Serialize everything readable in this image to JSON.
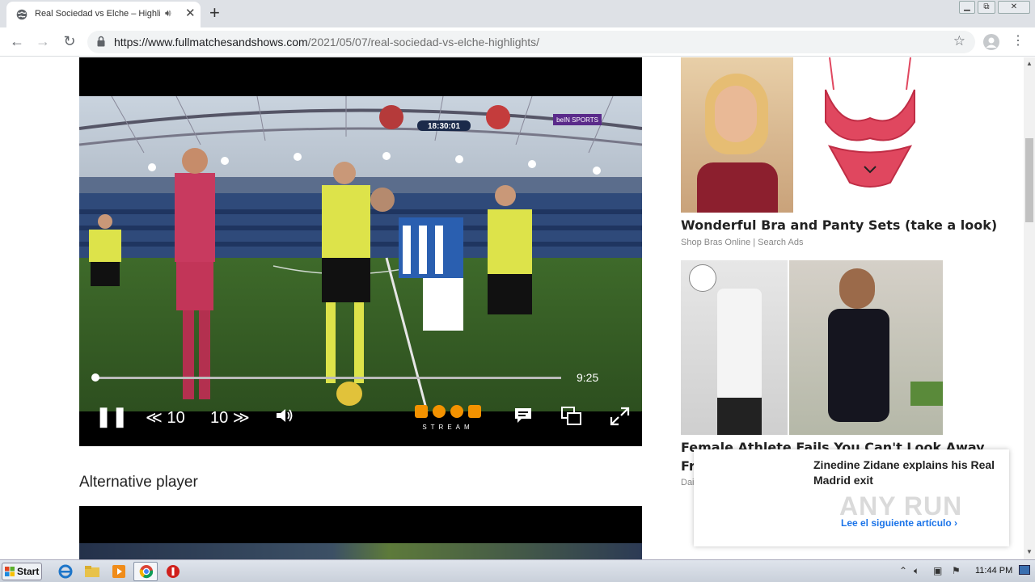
{
  "browser": {
    "tab_title": "Real Sociedad vs Elche – Highlig",
    "url_host": "https://www.fullmatchesandshows.com",
    "url_path": "/2021/05/07/real-sociedad-vs-elche-highlights/",
    "window_buttons": [
      "▭",
      "⧉",
      "✕"
    ]
  },
  "player": {
    "score_clock": "18:30:01",
    "channel": "beIN SPORTS",
    "time_remaining": "9:25",
    "progress": 0.0,
    "rewind_label": "10",
    "forward_label": "10",
    "brand": "STREAM"
  },
  "alternative": {
    "heading": "Alternative player"
  },
  "ads": [
    {
      "title": "Wonderful Bra and Panty Sets (take a look)",
      "source": "Shop Bras Online | Search Ads"
    },
    {
      "title": "Female Athlete Fails You Can't Look Away",
      "title_line2": "Fr",
      "source": "Dai"
    }
  ],
  "popup": {
    "title": "Zinedine Zidane explains his Real Madrid exit",
    "link": "Lee el siguiente artículo ›",
    "watermark": "ANY RUN"
  },
  "taskbar": {
    "start": "Start",
    "clock": "11:44 PM"
  }
}
